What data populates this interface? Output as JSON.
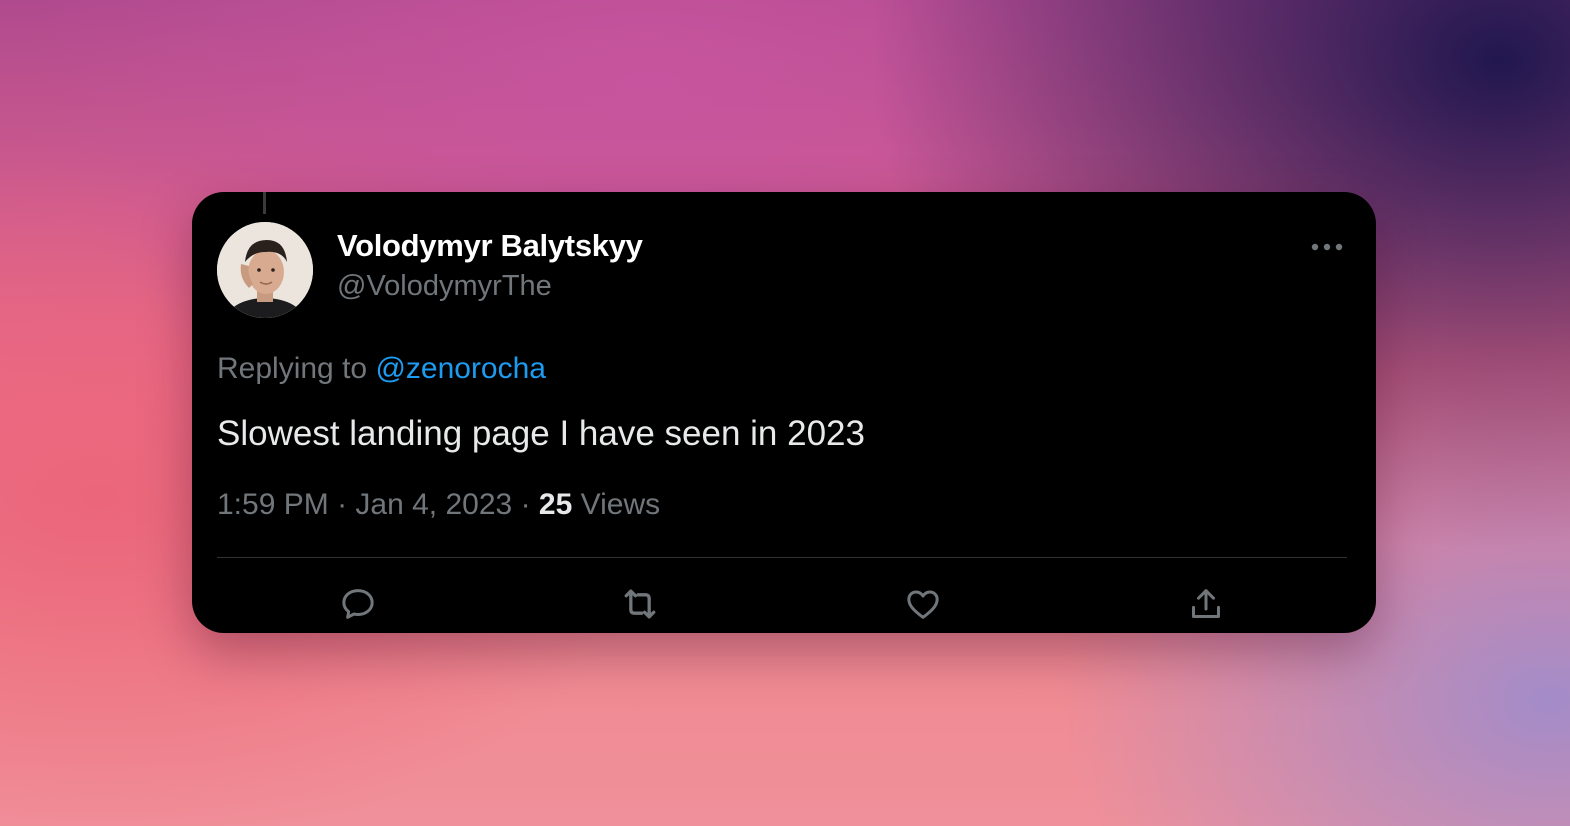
{
  "tweet": {
    "author": {
      "display_name": "Volodymyr Balytskyy",
      "handle": "@VolodymyrThe"
    },
    "replying_prefix": "Replying to",
    "replying_to": "@zenorocha",
    "text": "Slowest landing page I have seen in 2023",
    "time": "1:59 PM",
    "separator": "·",
    "date": "Jan 4, 2023",
    "views_count": "25",
    "views_label": "Views"
  },
  "actions": [
    {
      "name": "reply",
      "icon": "comment-bubble-icon"
    },
    {
      "name": "retweet",
      "icon": "retweet-icon"
    },
    {
      "name": "like",
      "icon": "heart-icon"
    },
    {
      "name": "share",
      "icon": "share-upload-icon"
    }
  ],
  "colors": {
    "card_background": "#000000",
    "primary_text": "#e7e9ea",
    "secondary_text": "#71767b",
    "mention_link": "#1d9bf0",
    "divider": "#2f3336"
  }
}
